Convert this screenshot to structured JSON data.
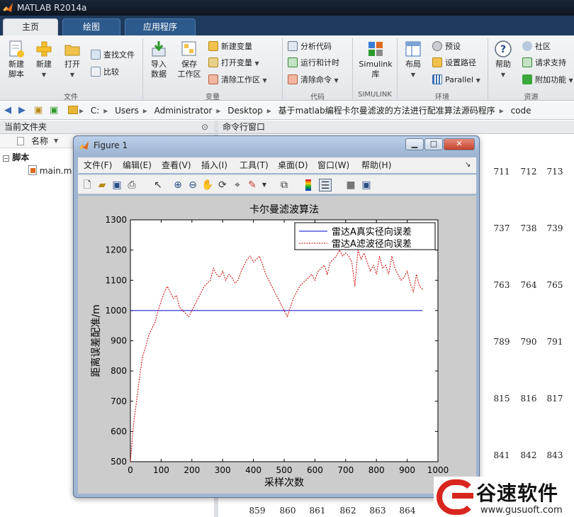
{
  "window": {
    "title": "MATLAB R2014a"
  },
  "tabs": [
    {
      "label": "主页",
      "active": true
    },
    {
      "label": "绘图",
      "active": false
    },
    {
      "label": "应用程序",
      "active": false
    }
  ],
  "ribbon": {
    "file": {
      "new_script": "新建",
      "new_script2": "脚本",
      "new": "新建",
      "open": "打开",
      "find_files": "查找文件",
      "compare": "比较",
      "group": "文件"
    },
    "variable": {
      "import": "导入",
      "import2": "数据",
      "save": "保存",
      "save2": "工作区",
      "new_var": "新建变量",
      "open_var": "打开变量",
      "clear_ws": "清除工作区",
      "group": "变量"
    },
    "code": {
      "analyze": "分析代码",
      "run_time": "运行和计时",
      "clear_cmd": "清除命令",
      "group": "代码"
    },
    "simulink": {
      "label": "Simulink",
      "label2": "库",
      "group": "SIMULINK"
    },
    "env": {
      "layout": "布局",
      "prefs": "预设",
      "set_path": "设置路径",
      "parallel": "Parallel",
      "group": "环境"
    },
    "resources": {
      "help": "帮助",
      "community": "社区",
      "request": "请求支持",
      "addons": "附加功能",
      "group": "资源"
    }
  },
  "address": {
    "path": [
      "C:",
      "Users",
      "Administrator",
      "Desktop",
      "基于matlab编程卡尔曼滤波的方法进行配准算法源码程序",
      "code"
    ]
  },
  "left_panel": {
    "title": "当前文件夹",
    "column_name": "名称",
    "group": "脚本",
    "file": "main.m"
  },
  "command_window": {
    "title": "命令行窗口",
    "rows": [
      [
        "711",
        "712",
        "713"
      ],
      [
        "737",
        "738",
        "739"
      ],
      [
        "763",
        "764",
        "765"
      ],
      [
        "789",
        "790",
        "791"
      ],
      [
        "815",
        "816",
        "817"
      ],
      [
        "841",
        "842",
        "843"
      ]
    ],
    "bottom_row": [
      "859",
      "860",
      "861",
      "862",
      "863",
      "864"
    ]
  },
  "figure": {
    "title": "Figure 1",
    "menu": [
      "文件(F)",
      "编辑(E)",
      "查看(V)",
      "插入(I)",
      "工具(T)",
      "桌面(D)",
      "窗口(W)",
      "帮助(H)"
    ]
  },
  "chart_data": {
    "type": "line",
    "title": "卡尔曼滤波算法",
    "xlabel": "采样次数",
    "ylabel": "距离误差配准/m",
    "xlim": [
      0,
      1000
    ],
    "ylim": [
      500,
      1300
    ],
    "xticks": [
      0,
      100,
      200,
      300,
      400,
      500,
      600,
      700,
      800,
      900,
      1000
    ],
    "yticks": [
      500,
      600,
      700,
      800,
      900,
      1000,
      1100,
      1200,
      1300
    ],
    "grid": false,
    "legend_position": "top-right",
    "series": [
      {
        "name": "雷达A真实径向误差",
        "color": "#0000cc",
        "style": "solid",
        "x": [
          0,
          950
        ],
        "y": [
          1000,
          1000
        ]
      },
      {
        "name": "雷达A滤波径向误差",
        "color": "#cc0000",
        "style": "dashed",
        "x": [
          0,
          5,
          10,
          20,
          30,
          40,
          50,
          60,
          70,
          80,
          90,
          100,
          110,
          120,
          130,
          140,
          150,
          160,
          170,
          180,
          190,
          200,
          210,
          220,
          230,
          240,
          250,
          260,
          270,
          280,
          290,
          300,
          310,
          320,
          330,
          340,
          350,
          360,
          370,
          380,
          390,
          400,
          410,
          420,
          430,
          440,
          450,
          460,
          470,
          480,
          490,
          500,
          510,
          520,
          530,
          540,
          550,
          560,
          570,
          580,
          590,
          600,
          610,
          620,
          630,
          640,
          650,
          660,
          670,
          680,
          690,
          700,
          710,
          720,
          730,
          740,
          750,
          760,
          770,
          780,
          790,
          800,
          810,
          820,
          830,
          840,
          850,
          860,
          870,
          880,
          890,
          900,
          910,
          920,
          930,
          940,
          950
        ],
        "y": [
          500,
          560,
          620,
          700,
          780,
          850,
          880,
          920,
          940,
          960,
          1000,
          1030,
          1060,
          1080,
          1060,
          1040,
          1050,
          1010,
          1000,
          990,
          980,
          1000,
          1020,
          1040,
          1060,
          1080,
          1090,
          1100,
          1140,
          1120,
          1110,
          1130,
          1100,
          1120,
          1110,
          1090,
          1100,
          1130,
          1150,
          1170,
          1180,
          1160,
          1170,
          1180,
          1150,
          1120,
          1100,
          1080,
          1060,
          1040,
          1020,
          1000,
          980,
          1010,
          1040,
          1060,
          1080,
          1090,
          1100,
          1110,
          1120,
          1100,
          1130,
          1140,
          1150,
          1120,
          1160,
          1170,
          1180,
          1200,
          1180,
          1190,
          1180,
          1160,
          1080,
          1200,
          1170,
          1190,
          1160,
          1130,
          1150,
          1120,
          1180,
          1140,
          1150,
          1120,
          1180,
          1140,
          1120,
          1100,
          1110,
          1130,
          1090,
          1060,
          1120,
          1080,
          1070
        ]
      }
    ]
  },
  "watermark": {
    "name": "谷速软件",
    "url": "www.gusuoft.com"
  },
  "colors": {
    "titlebar": "#0d1520",
    "tabrow": "#1e3a5c",
    "ribbon": "#e9ecef",
    "figure_frame": "#9fb6d3",
    "watermark_red": "#d8261e"
  }
}
